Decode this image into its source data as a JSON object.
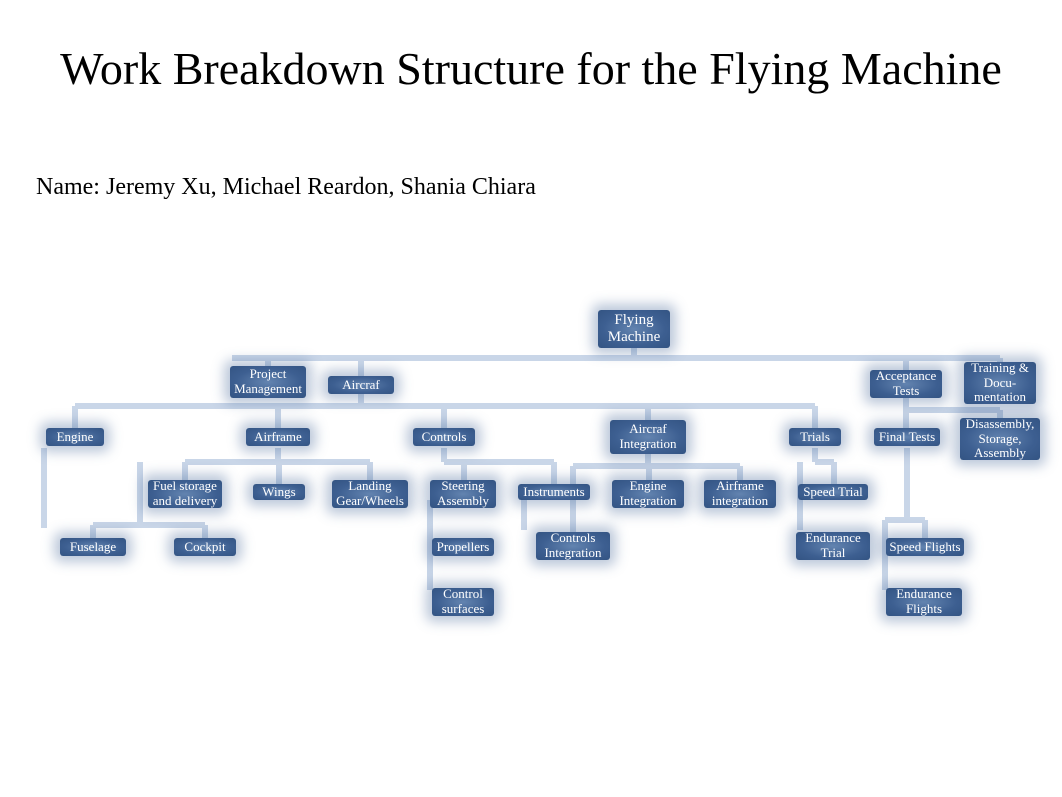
{
  "title": "Work Breakdown Structure for the Flying Machine",
  "names": "Name: Jeremy Xu, Michael Reardon, Shania Chiara",
  "nodes": {
    "root": "Flying\nMachine",
    "pm": "Project\nManagement",
    "aircraft": "Aircraf",
    "accept": "Acceptance\nTests",
    "training": "Training &\nDocu-\nmentation",
    "engine": "Engine",
    "airframe": "Airframe",
    "controls": "Controls",
    "aint": "Aircraf\nIntegration",
    "trials": "Trials",
    "finaltests": "Final Tests",
    "disasm": "Disassembly,\nStorage,\nAssembly",
    "fuel": "Fuel storage\nand delivery",
    "wings": "Wings",
    "landing": "Landing\nGear/Wheels",
    "steering": "Steering\nAssembly",
    "instruments": "Instruments",
    "engint": "Engine\nIntegration",
    "airint": "Airframe\nintegration",
    "speedtrial": "Speed Trial",
    "fuselage": "Fuselage",
    "cockpit": "Cockpit",
    "propellers": "Propellers",
    "ctrlint": "Controls\nIntegration",
    "endtrial": "Endurance\nTrial",
    "speedflights": "Speed Flights",
    "ctrlsurf": "Control\nsurfaces",
    "endflights": "Endurance\nFlights"
  },
  "colors": {
    "node": "#3d5f91",
    "connector": "#c9d6e8"
  },
  "chart_data": {
    "type": "tree",
    "title": "Work Breakdown Structure for the Flying Machine",
    "root": {
      "name": "Flying Machine",
      "children": [
        {
          "name": "Project Management"
        },
        {
          "name": "Aircraf",
          "children": [
            {
              "name": "Engine"
            },
            {
              "name": "Airframe",
              "children": [
                {
                  "name": "Fuel storage and delivery"
                },
                {
                  "name": "Wings"
                },
                {
                  "name": "Landing Gear/Wheels"
                },
                {
                  "name": "Fuselage"
                },
                {
                  "name": "Cockpit"
                }
              ]
            },
            {
              "name": "Controls",
              "children": [
                {
                  "name": "Steering Assembly"
                },
                {
                  "name": "Instruments"
                },
                {
                  "name": "Propellers"
                },
                {
                  "name": "Control surfaces"
                }
              ]
            },
            {
              "name": "Aircraf Integration",
              "children": [
                {
                  "name": "Engine Integration"
                },
                {
                  "name": "Airframe integration"
                },
                {
                  "name": "Controls Integration"
                }
              ]
            },
            {
              "name": "Trials",
              "children": [
                {
                  "name": "Speed Trial"
                },
                {
                  "name": "Endurance Trial"
                }
              ]
            }
          ]
        },
        {
          "name": "Acceptance Tests",
          "children": [
            {
              "name": "Final Tests",
              "children": [
                {
                  "name": "Speed Flights"
                },
                {
                  "name": "Endurance Flights"
                }
              ]
            },
            {
              "name": "Disassembly, Storage, Assembly"
            }
          ]
        },
        {
          "name": "Training & Docu-mentation"
        }
      ]
    }
  }
}
